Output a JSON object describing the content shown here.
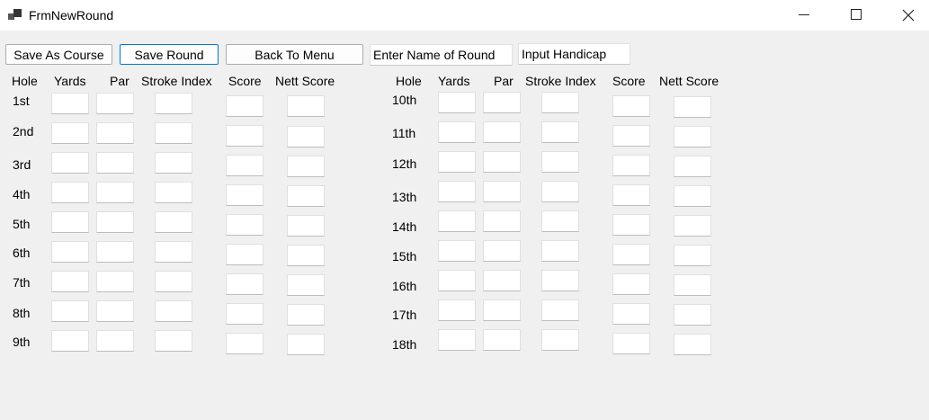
{
  "window": {
    "title": "FrmNewRound"
  },
  "toolbar": {
    "save_as_course": "Save As Course",
    "save_round": "Save Round",
    "back_to_menu": "Back To Menu",
    "round_name_value": "Enter Name of Round",
    "handicap_value": "Input Handicap"
  },
  "headers": {
    "hole": "Hole",
    "yards": "Yards",
    "par": "Par",
    "stroke_index": "Stroke Index",
    "score": "Score",
    "nett_score": "Nett Score"
  },
  "holes": [
    "1st",
    "2nd",
    "3rd",
    "4th",
    "5th",
    "6th",
    "7th",
    "8th",
    "9th",
    "10th",
    "11th",
    "12th",
    "13th",
    "14th",
    "15th",
    "16th",
    "17th",
    "18th"
  ]
}
